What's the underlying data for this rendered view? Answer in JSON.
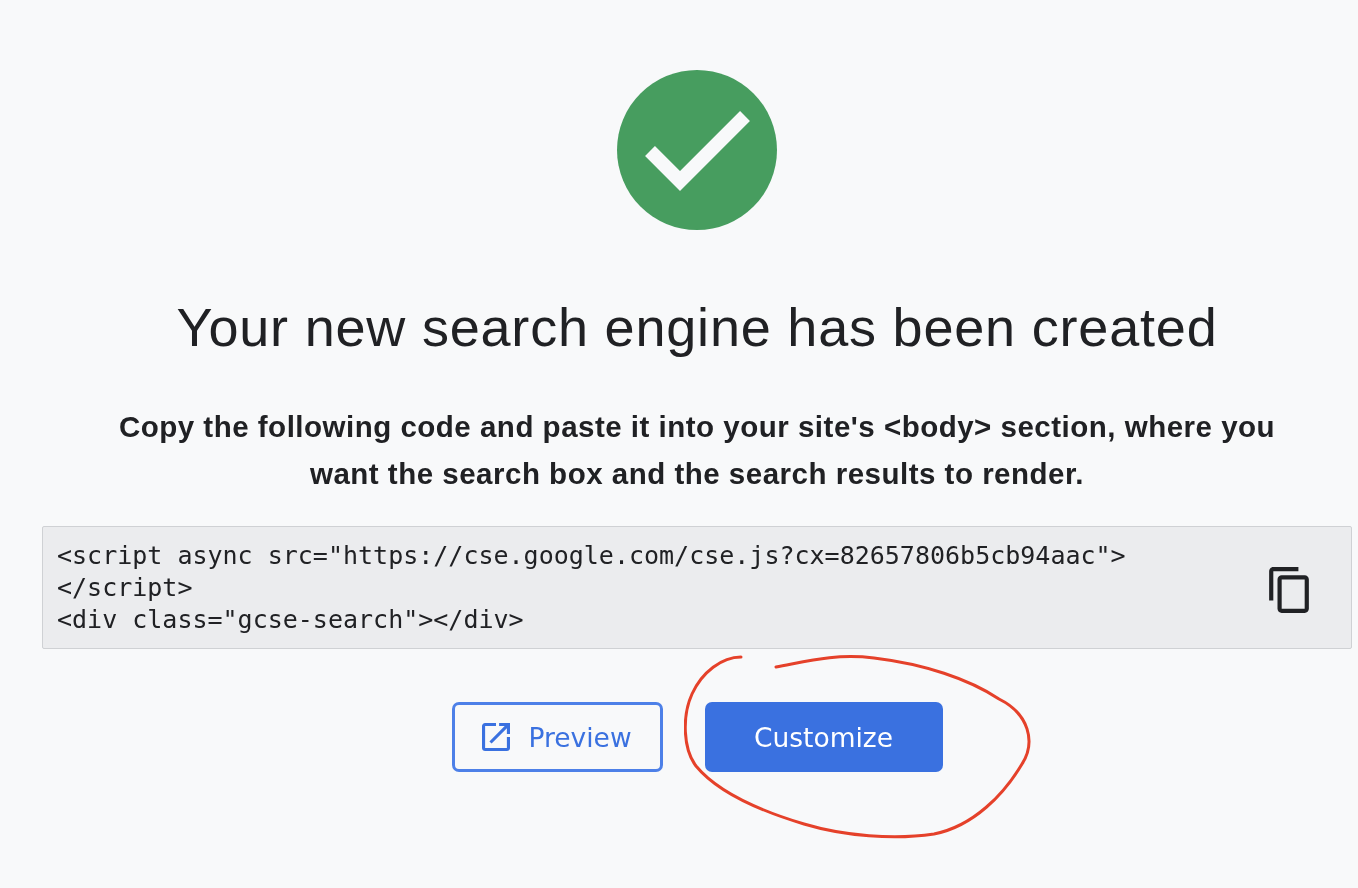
{
  "heading": {
    "title": "Your new search engine has been created"
  },
  "instructions": "Copy the following code and paste it into your site's <body> section, where you want the search box and the search results to render.",
  "code_snippet": {
    "lines": [
      "<script async src=\"https://cse.google.com/cse.js?cx=82657806b5cb94aac\">",
      "</script>",
      "<div class=\"gcse-search\"></div>"
    ]
  },
  "buttons": [
    {
      "label": "Preview",
      "kind": "outlined"
    },
    {
      "label": "Customize",
      "kind": "filled"
    }
  ]
}
